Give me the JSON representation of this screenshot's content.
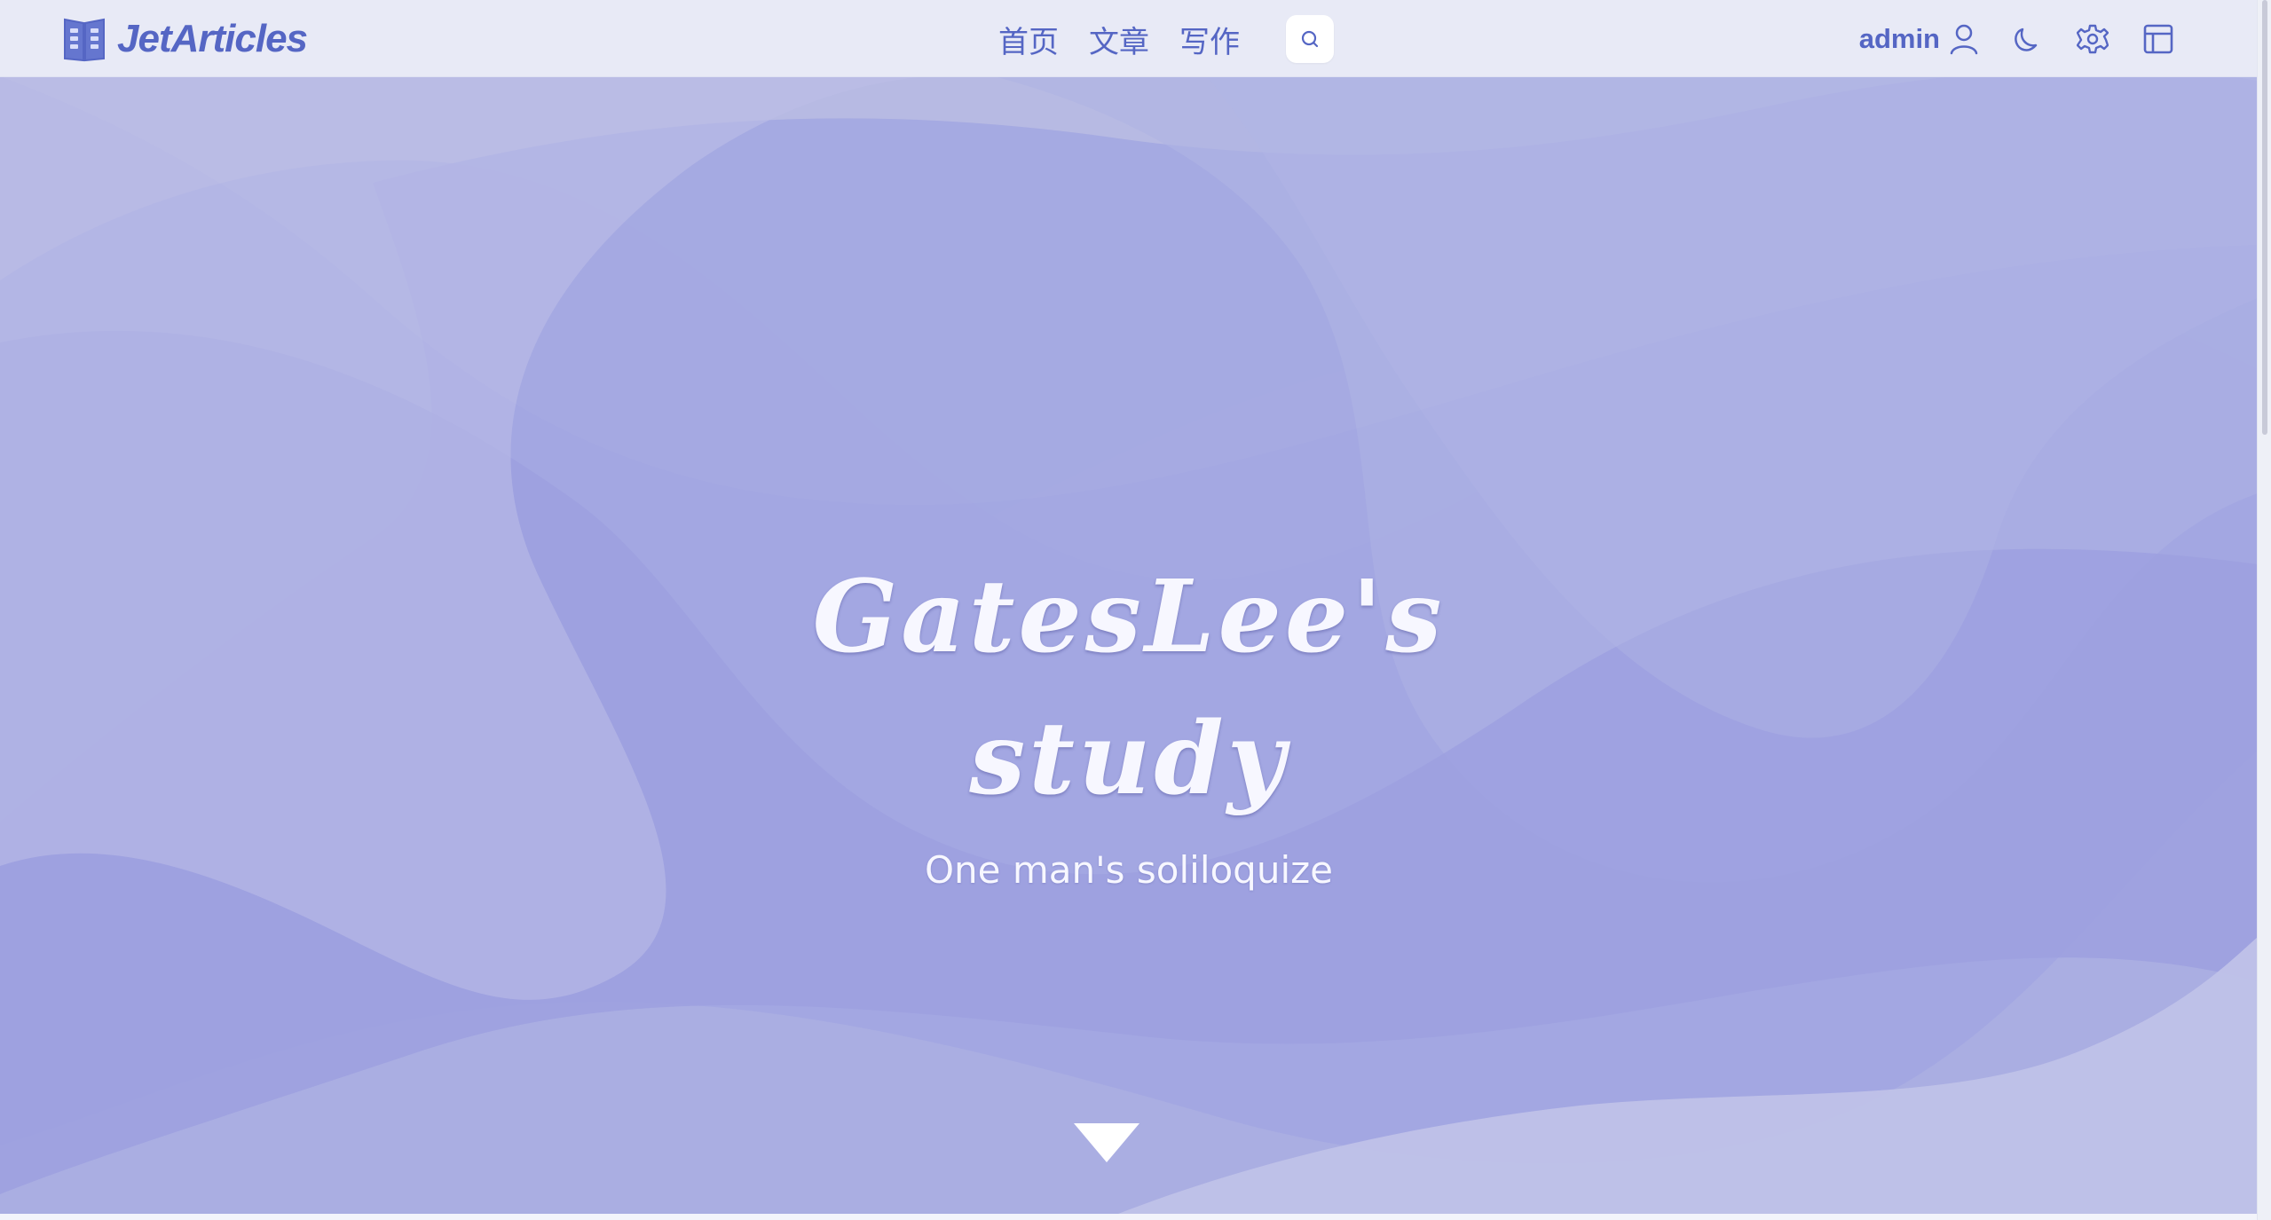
{
  "brand": {
    "name": "JetArticles",
    "logo_icon": "open-book-icon"
  },
  "nav": {
    "items": [
      {
        "label": "首页"
      },
      {
        "label": "文章"
      },
      {
        "label": "写作"
      }
    ],
    "search_icon": "search-icon"
  },
  "user": {
    "name": "admin",
    "icon": "user-icon"
  },
  "actions": {
    "theme_icon": "moon-icon",
    "settings_icon": "gear-icon",
    "layout_icon": "layout-icon"
  },
  "hero": {
    "title_line1": "GatesLee's",
    "title_line2": "study",
    "subtitle": "One man's soliloquize",
    "scroll_icon": "triangle-down-icon"
  },
  "colors": {
    "accent": "#5566c4",
    "navbar_bg": "#e8eaf6",
    "hero_text": "#f7f7ff",
    "hero_shape_1": "#c2c4e6",
    "hero_shape_2": "#b6b9e3",
    "hero_shape_3": "#a8ade3",
    "hero_shape_4": "#9da2e0"
  }
}
